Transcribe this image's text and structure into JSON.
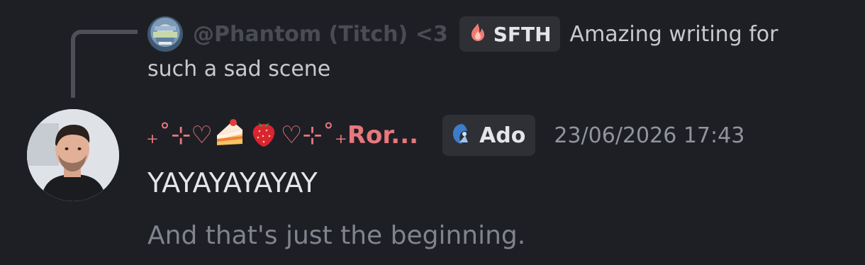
{
  "reply": {
    "author": "@Phantom (Titch) <3",
    "tag": {
      "label": "SFTH",
      "icon": "flame-icon"
    },
    "preview_line1": "Amazing writing for",
    "preview_line2": "such a sad scene"
  },
  "message": {
    "username_deco_left": "₊˚⊹♡",
    "username_deco_right": "♡⊹˚₊",
    "username_text": "Ror...",
    "emojis": [
      "cake-icon",
      "strawberry-icon"
    ],
    "tag": {
      "label": "Ado",
      "icon": "ado-guild-icon"
    },
    "timestamp": "23/06/2026 17:43",
    "lines": [
      "YAYAYAYAYAY",
      "And that's just the beginning."
    ]
  },
  "colors": {
    "background": "#1e1f24",
    "username": "#e8787c",
    "tag_bg": "#2e3036"
  }
}
